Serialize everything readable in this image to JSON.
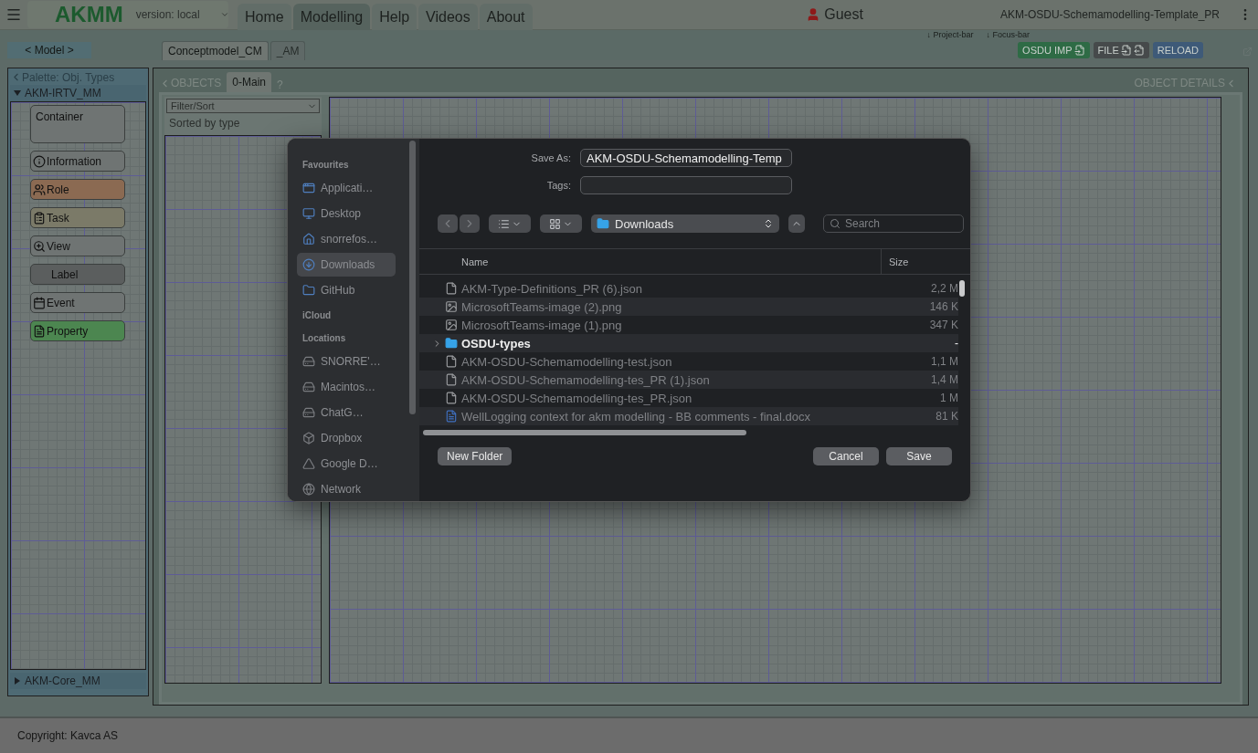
{
  "top_bar": {
    "logo": "AKMM",
    "version": "version: local",
    "nav": [
      {
        "label": "Home",
        "selected": false
      },
      {
        "label": "Modelling",
        "selected": true
      },
      {
        "label": "Help",
        "selected": false
      },
      {
        "label": "Videos",
        "selected": false
      },
      {
        "label": "About",
        "selected": false
      }
    ],
    "user": "Guest",
    "project_title": "AKM-OSDU-Schemamodelling-Template_PR"
  },
  "bar_hints": [
    "↓ Project-bar",
    "↓ Focus-bar"
  ],
  "model_button": "< Model >",
  "model_tabs": [
    {
      "label": "Conceptmodel_CM",
      "selected": true
    },
    {
      "label": "_AM",
      "selected": false
    }
  ],
  "actions": [
    {
      "label": "OSDU IMP",
      "kind": "import"
    },
    {
      "label": "FILE",
      "kind": "file"
    },
    {
      "label": "RELOAD",
      "kind": "reload"
    }
  ],
  "palette": {
    "title": "Palette: Obj. Types",
    "groups": [
      {
        "name": "AKM-IRTV_MM",
        "expanded": true,
        "items": [
          {
            "label": "Container",
            "kind": "container",
            "color": "#6f7473"
          },
          {
            "label": "Information",
            "kind": "information",
            "color": "#6f7473"
          },
          {
            "label": "Role",
            "kind": "role",
            "color": "#8b6a52"
          },
          {
            "label": "Task",
            "kind": "task",
            "color": "#7b7a68"
          },
          {
            "label": "View",
            "kind": "view",
            "color": "#6f7473"
          },
          {
            "label": "Label",
            "kind": "label",
            "color": "#5b5e5e"
          },
          {
            "label": "Event",
            "kind": "event",
            "color": "#6f7473"
          },
          {
            "label": "Property",
            "kind": "property",
            "color": "#4c8650"
          }
        ]
      },
      {
        "name": "AKM-Core_MM",
        "expanded": false
      }
    ]
  },
  "objects_panel": {
    "title": "OBJECTS",
    "filter": "Filter/Sort",
    "sort_note": "Sorted by type"
  },
  "diagram_tabs": [
    {
      "label": "0-Main",
      "selected": true
    }
  ],
  "help": "?",
  "details_title": "OBJECT DETAILS",
  "footer": "Copyright: Kavca AS",
  "save_dialog": {
    "save_as_label": "Save As:",
    "save_as_value": "AKM-OSDU-Schemamodelling-Temp",
    "tags_label": "Tags:",
    "sidebar": [
      {
        "title": "Favourites",
        "items": [
          {
            "label": "Applicati…",
            "kind": "apps",
            "selected": false
          },
          {
            "label": "Desktop",
            "kind": "desktop",
            "selected": false
          },
          {
            "label": "snorrefos…",
            "kind": "home",
            "selected": false
          },
          {
            "label": "Downloads",
            "kind": "downloads",
            "selected": true
          },
          {
            "label": "GitHub",
            "kind": "folder",
            "selected": false
          }
        ]
      },
      {
        "title": "iCloud"
      },
      {
        "title": "Locations",
        "items": [
          {
            "label": "SNORRE'…",
            "kind": "drive",
            "selected": false
          },
          {
            "label": "Macintos…",
            "kind": "disk",
            "selected": false
          },
          {
            "label": "ChatG…",
            "kind": "ejectable",
            "selected": false
          },
          {
            "label": "Dropbox",
            "kind": "dropbox",
            "selected": false
          },
          {
            "label": "Google D…",
            "kind": "gdrive",
            "selected": false
          },
          {
            "label": "Network",
            "kind": "network",
            "selected": false
          }
        ]
      }
    ],
    "location": "Downloads",
    "search_placeholder": "Search",
    "columns": [
      "Name",
      "Size"
    ],
    "files": [
      {
        "name": "AKM-Type-Definitions_PR (6).json",
        "size": "2,2 M",
        "kind": "file",
        "disabled": true
      },
      {
        "name": "MicrosoftTeams-image (2).png",
        "size": "146 K",
        "kind": "image",
        "disabled": true
      },
      {
        "name": "MicrosoftTeams-image (1).png",
        "size": "347 K",
        "kind": "image",
        "disabled": true
      },
      {
        "name": "OSDU-types",
        "size": "-",
        "kind": "folder",
        "disabled": false
      },
      {
        "name": "AKM-OSDU-Schemamodelling-test.json",
        "size": "1,1 M",
        "kind": "file",
        "disabled": true
      },
      {
        "name": "AKM-OSDU-Schemamodelling-tes_PR (1).json",
        "size": "1,4 M",
        "kind": "file",
        "disabled": true
      },
      {
        "name": "AKM-OSDU-Schemamodelling-tes_PR.json",
        "size": "1 M",
        "kind": "file",
        "disabled": true
      },
      {
        "name": "WellLogging context for akm modelling - BB comments - final.docx",
        "size": "81 K",
        "kind": "word",
        "disabled": true
      }
    ],
    "buttons": [
      {
        "label": "New Folder",
        "kind": "new"
      },
      {
        "label": "Cancel",
        "kind": "cancel"
      },
      {
        "label": "Save",
        "kind": "save"
      }
    ]
  }
}
